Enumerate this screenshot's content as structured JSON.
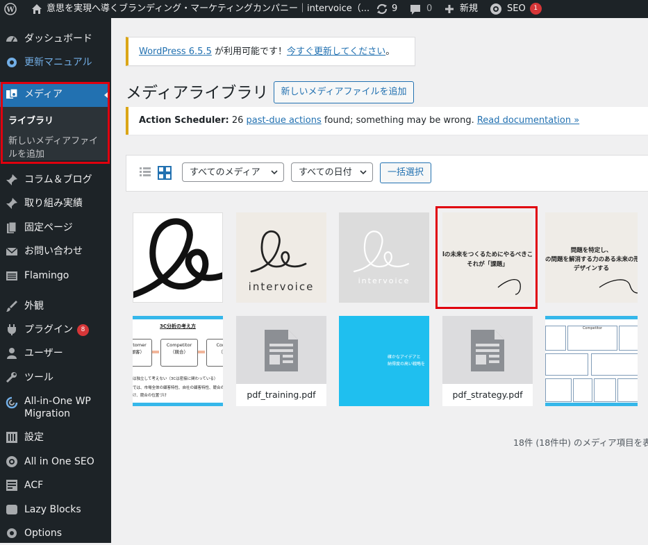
{
  "admin_bar": {
    "site_title": "意思を実現へ導くブランディング・マーケティングカンパニー｜intervoice（...",
    "updates_count": "9",
    "comments_count": "0",
    "new_label": "新規",
    "seo_label": "SEO",
    "seo_count": "1"
  },
  "sidebar": {
    "items": [
      {
        "label": "ダッシュボード",
        "icon": "dashboard-icon"
      },
      {
        "label": "更新マニュアル",
        "icon": "gear-icon"
      },
      {
        "label": "メディア",
        "icon": "media-icon"
      },
      {
        "label": "コラム＆ブログ",
        "icon": "pin-icon"
      },
      {
        "label": "取り組み実績",
        "icon": "pin-icon"
      },
      {
        "label": "固定ページ",
        "icon": "page-icon"
      },
      {
        "label": "お問い合わせ",
        "icon": "mail-icon"
      },
      {
        "label": "Flamingo",
        "icon": "list-icon"
      },
      {
        "label": "外観",
        "icon": "brush-icon"
      },
      {
        "label": "プラグイン",
        "icon": "plugin-icon",
        "badge": "8"
      },
      {
        "label": "ユーザー",
        "icon": "user-icon"
      },
      {
        "label": "ツール",
        "icon": "wrench-icon"
      },
      {
        "label": "All-in-One WP Migration",
        "icon": "migration-icon"
      },
      {
        "label": "設定",
        "icon": "settings-icon"
      },
      {
        "label": "All in One SEO",
        "icon": "seo-icon"
      },
      {
        "label": "ACF",
        "icon": "acf-icon"
      },
      {
        "label": "Lazy Blocks",
        "icon": "blocks-icon"
      },
      {
        "label": "Options",
        "icon": "options-icon"
      }
    ],
    "submenu": {
      "library": "ライブラリ",
      "add_new_line1": "新しいメディアファイ",
      "add_new_line2": "ルを追加"
    }
  },
  "update_notice": {
    "link1": "WordPress 6.5.5",
    "text": " が利用可能です！",
    "link2": "今すぐ更新してください",
    "end": "。"
  },
  "page": {
    "title": "メディアライブラリ",
    "add_new": "新しいメディアファイルを追加"
  },
  "scheduler_notice": {
    "label": "Action Scheduler:",
    "count": " 26 ",
    "link": "past-due actions",
    "text": " found; something may be wrong. ",
    "doc_link": "Read documentation »"
  },
  "toolbar": {
    "filter_type": "すべてのメディア",
    "filter_date": "すべての日付",
    "bulk_select": "一括選択"
  },
  "media": {
    "logo_text": "intervoice",
    "thumb4_line1": "lの未来をつくるためにやるべきこ",
    "thumb4_line2": "それが「課題」",
    "thumb5_line1": "問題を特定し、",
    "thumb5_line2": "の問題を解消する力のある未来の形",
    "thumb5_line3": "デザインする",
    "thumb6_title": "3C分析の考え方",
    "thumb6_box1": "Customer",
    "thumb6_box1b": "（顧客）",
    "thumb6_box2": "Competitor",
    "thumb6_box2b": "（競合）",
    "thumb6_box3": "Comp",
    "thumb6_box3b": "（自",
    "thumb6_note": "は独立して考えない（3Cは密接に関わっている）",
    "thumb6_note2": "では、市場全体の顧客特性、自社の顧客特性、競合の顧",
    "thumb6_note3": "け、競合の位置づけ",
    "pdf1": "pdf_training.pdf",
    "thumb8_line1": "確かなアイデアと",
    "thumb8_line2": "納得度の高い戦略を",
    "pdf2": "pdf_strategy.pdf",
    "thumb10_label": "Competitor"
  },
  "footer": {
    "count_text": "18件 (18件中) のメディア項目を表"
  },
  "colors": {
    "highlight": "#e0000e",
    "sidebar": "#1d2327",
    "active": "#2271b1",
    "link": "#2271b1"
  }
}
